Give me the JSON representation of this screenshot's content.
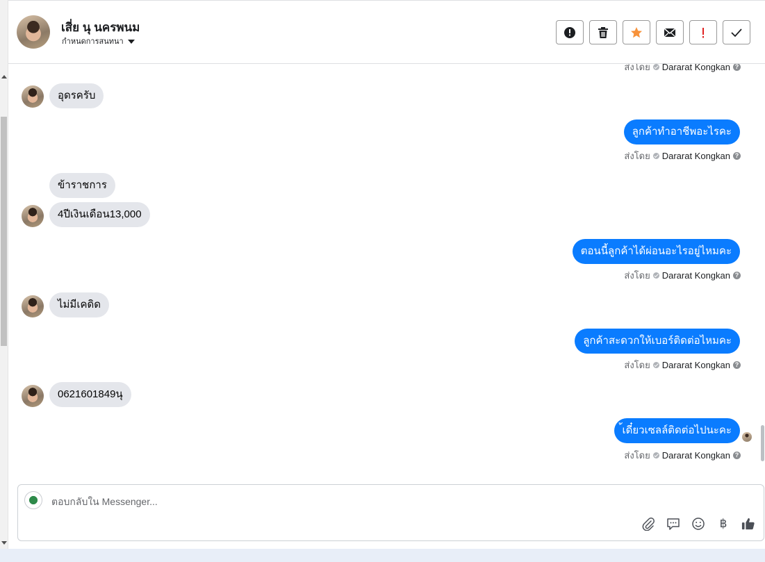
{
  "header": {
    "contact_name": "เสี่ย นุ นครพนม",
    "assign_label": "กำหนดการสนทนา",
    "toolbar": {
      "spam_icon": "alert-circle-icon",
      "delete_icon": "trash-icon",
      "star_icon": "star-icon",
      "mail_icon": "envelope-icon",
      "important_icon": "exclamation-icon",
      "done_icon": "check-icon"
    }
  },
  "conversation": {
    "sent_by_label": "ส่งโดย",
    "agent_name": "Dararat Kongkan",
    "messages": [
      {
        "from": "customer",
        "text": "อุดรครับ"
      },
      {
        "from": "page",
        "text": "ลูกค้าทำอาชีพอะไรคะ"
      },
      {
        "from": "customer",
        "text": "ข้าราชการ"
      },
      {
        "from": "customer",
        "text": "4ปีเงินเดือน13,000"
      },
      {
        "from": "page",
        "text": "ตอนนี้ลูกค้าได้ผ่อนอะไรอยู่ไหมคะ"
      },
      {
        "from": "customer",
        "text": "ไม่มีเคดิด"
      },
      {
        "from": "page",
        "text": "ลูกค้าสะดวกให้เบอร์ติดต่อไหมคะ"
      },
      {
        "from": "customer",
        "text": "0621601849นุ"
      },
      {
        "from": "page",
        "text": "้เดี๋ยวเซลล์ติดต่อไปนะคะ"
      }
    ]
  },
  "composer": {
    "placeholder": "ตอบกลับใน Messenger...",
    "baht_symbol": "฿",
    "icons": [
      "paperclip-icon",
      "saved-reply-icon",
      "emoji-icon",
      "baht-icon",
      "thumbs-up-icon"
    ]
  },
  "colors": {
    "outgoing_bubble": "#0a7cff",
    "incoming_bubble": "#e4e6eb",
    "star": "#f7923a",
    "important": "#e02020"
  }
}
